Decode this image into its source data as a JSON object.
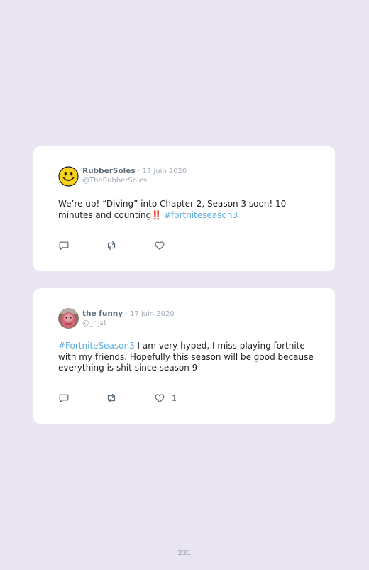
{
  "tweets": [
    {
      "display_name": "RubberSoles",
      "separator": "·",
      "date": "17 juin 2020",
      "handle": "@TheRubberSoles",
      "avatar": "smiley-face",
      "text_before": "We’re up! “Diving” into Chapter 2, Season 3 soon! 10 minutes and counting",
      "emoji": "‼️",
      "hashtag": "#fortniteseason3",
      "text_after": "",
      "like_count": ""
    },
    {
      "display_name": "the funny",
      "separator": "·",
      "date": "17 juin 2020",
      "handle": "@_rijst",
      "avatar": "profile-photo",
      "text_before": "",
      "emoji": "",
      "hashtag": "#FortniteSeason3",
      "text_after": " I am very hyped, I miss playing fortnite with my friends. Hopefully this season will be good because everything is shit since season 9",
      "like_count": "1"
    }
  ],
  "icons": {
    "reply": "reply-icon",
    "retweet": "retweet-icon",
    "like": "heart-icon"
  },
  "colors": {
    "background": "#e9e6f1",
    "card": "#ffffff",
    "hashtag": "#5aaee0",
    "name": "#5d6b78",
    "meta": "#a3acb6"
  },
  "page_number": "231"
}
